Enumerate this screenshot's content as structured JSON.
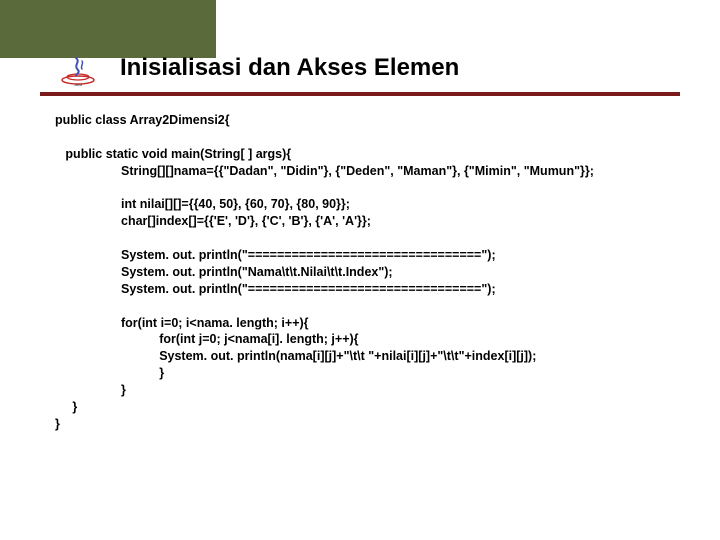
{
  "slide": {
    "title": "Inisialisasi dan Akses Elemen"
  },
  "code": {
    "l1": "public class Array2Dimensi2{",
    "l2": "public static void main(String[ ] args){",
    "l3": "String[][]nama={{\"Dadan\", \"Didin\"}, {\"Deden\", \"Maman\"}, {\"Mimin\", \"Mumun\"}};",
    "l4": "int nilai[][]={{40, 50}, {60, 70}, {80, 90}};",
    "l5": "char[]index[]={{'E', 'D'}, {'C', 'B'}, {'A', 'A'}};",
    "l6": "System. out. println(\"================================\");",
    "l7": "System. out. println(\"Nama\\t\\t.Nilai\\t\\t.Index\");",
    "l8": "System. out. println(\"================================\");",
    "l9": "for(int i=0; i<nama. length; i++){",
    "l10": "for(int j=0; j<nama[i]. length; j++){",
    "l11": "System. out. println(nama[i][j]+\"\\t\\t \"+nilai[i][j]+\"\\t\\t\"+index[i][j]);",
    "l12": "}",
    "l13": "}",
    "l14": "}",
    "l15": "}"
  }
}
